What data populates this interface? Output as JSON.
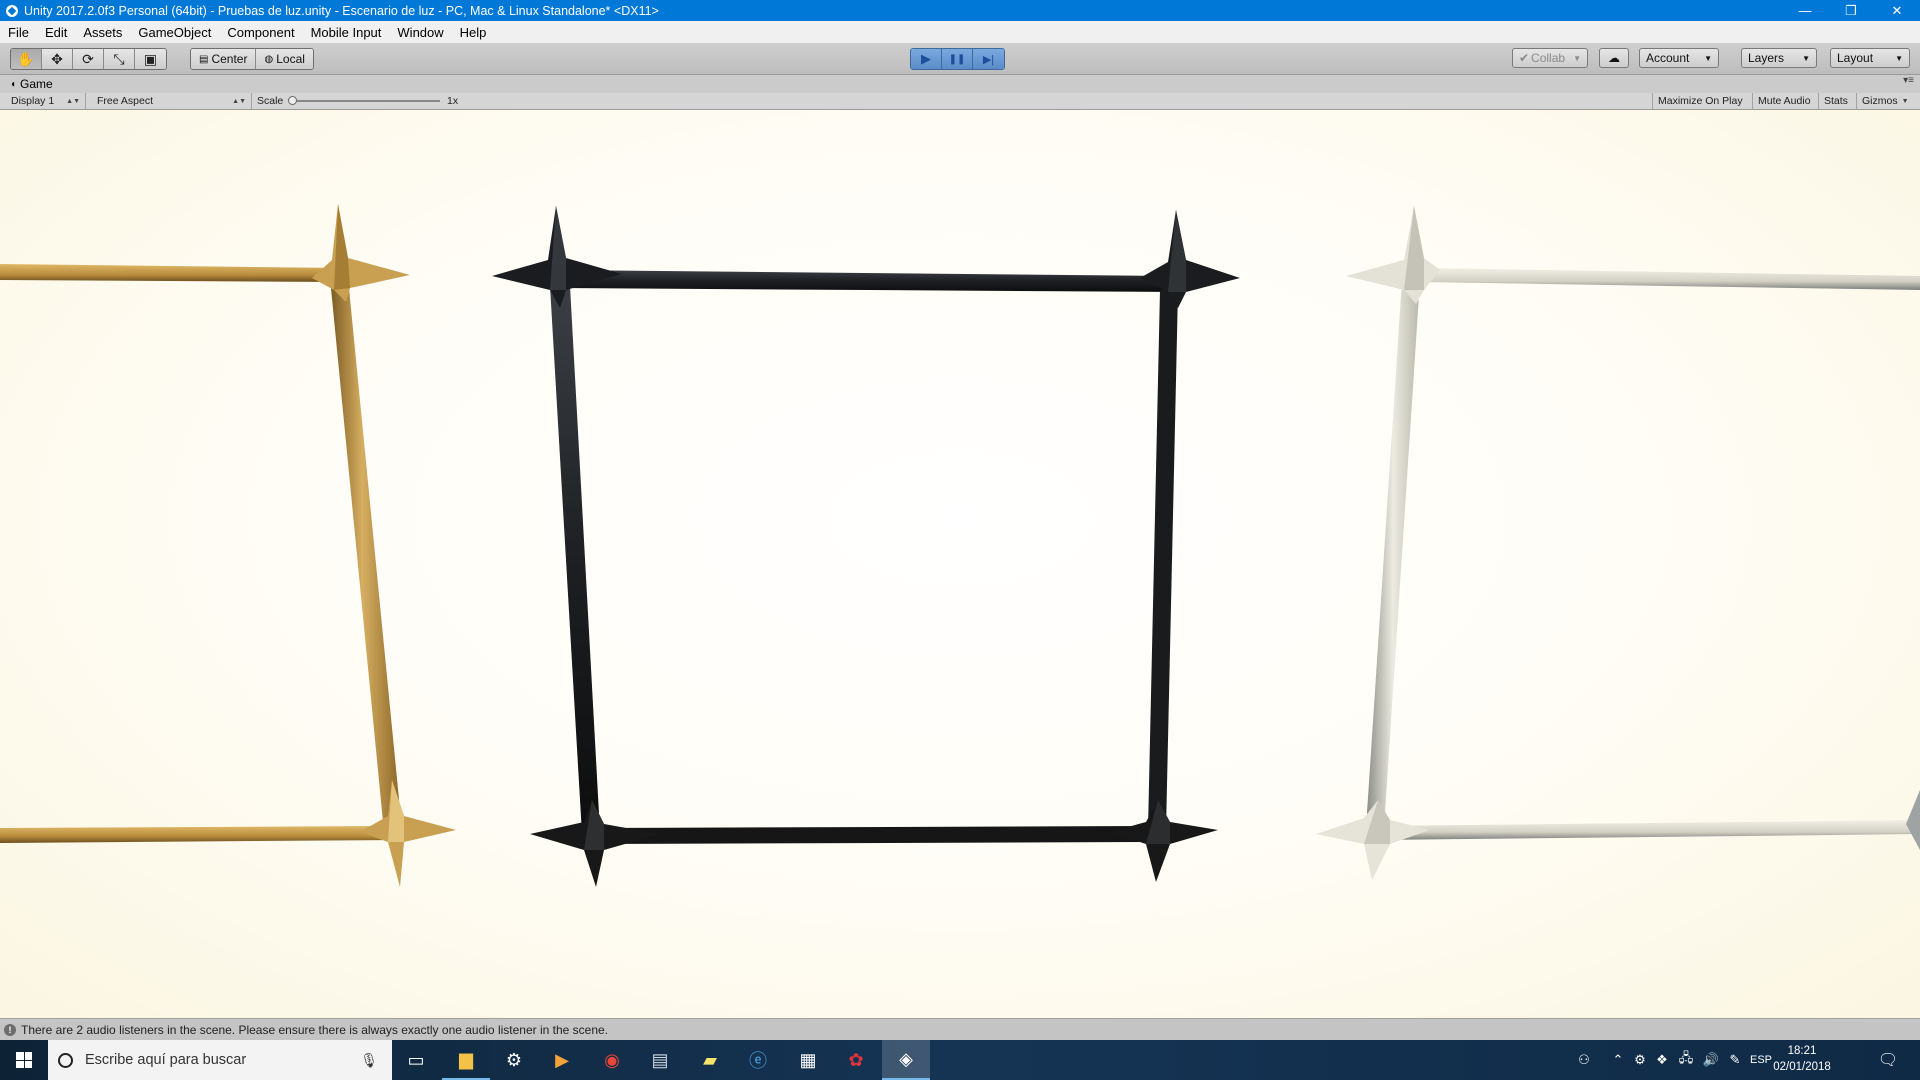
{
  "window": {
    "title": "Unity 2017.2.0f3 Personal (64bit) - Pruebas de luz.unity - Escenario de luz - PC, Mac & Linux Standalone* <DX11>",
    "minimize": "—",
    "restore": "❐",
    "close": "✕"
  },
  "menu": [
    "File",
    "Edit",
    "Assets",
    "GameObject",
    "Component",
    "Mobile Input",
    "Window",
    "Help"
  ],
  "toolbar": {
    "tools": [
      "✋",
      "✥",
      "⟳",
      "⤡",
      "▣"
    ],
    "pivot": "Center",
    "rotation": "Local",
    "play": "▶",
    "pause": "❚❚",
    "step": "▶|",
    "collab": "Collab",
    "cloud": "☁",
    "account": "Account",
    "layers": "Layers",
    "layout": "Layout"
  },
  "game_panel": {
    "tab_label": "Game",
    "display": "Display 1",
    "aspect": "Free Aspect",
    "scale_label": "Scale",
    "scale_value": "1x",
    "maximize_on_play": "Maximize On Play",
    "mute_audio": "Mute Audio",
    "stats": "Stats",
    "gizmos": "Gizmos"
  },
  "frame_colors": {
    "gold": "#c9a052",
    "black": "#1c1c1c",
    "silver": "#dcd9cc"
  },
  "status_message": "There are 2 audio listeners in the scene. Please ensure there is always exactly one audio listener in the scene.",
  "taskbar": {
    "search_placeholder": "Escribe aquí para buscar",
    "language": "ESP",
    "time": "18:21",
    "date": "02/01/2018"
  }
}
